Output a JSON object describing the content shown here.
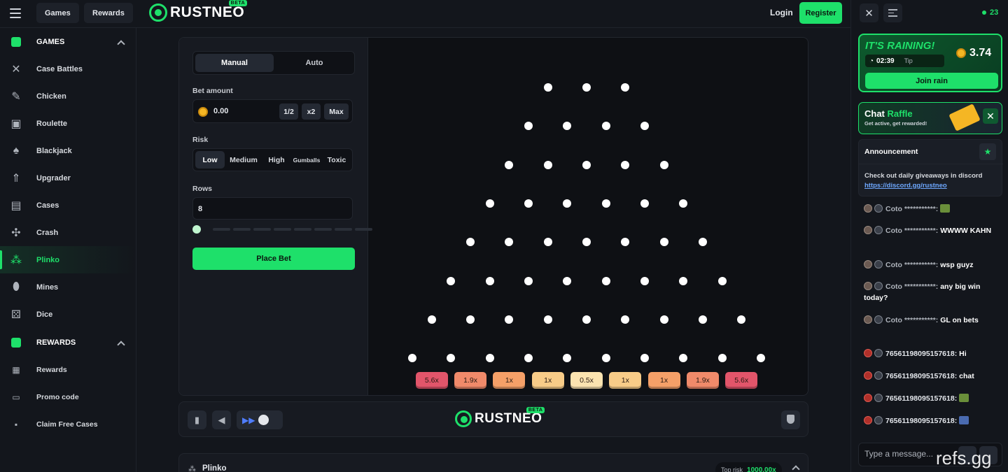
{
  "topbar": {
    "tabs": [
      "Games",
      "Rewards"
    ],
    "logo_text": "RUSTNEO",
    "logo_badge": "BETA",
    "login_label": "Login",
    "register_label": "Register"
  },
  "sidebar": {
    "games_section": "GAMES",
    "games": [
      {
        "label": "Case Battles",
        "icon": "swords-icon"
      },
      {
        "label": "Chicken",
        "icon": "feather-icon"
      },
      {
        "label": "Roulette",
        "icon": "roulette-icon"
      },
      {
        "label": "Blackjack",
        "icon": "cards-icon"
      },
      {
        "label": "Upgrader",
        "icon": "chevrons-up-icon"
      },
      {
        "label": "Cases",
        "icon": "case-icon"
      },
      {
        "label": "Crash",
        "icon": "drone-icon"
      },
      {
        "label": "Plinko",
        "icon": "plinko-icon",
        "active": true
      },
      {
        "label": "Mines",
        "icon": "grenade-icon"
      },
      {
        "label": "Dice",
        "icon": "dice-icon"
      }
    ],
    "rewards_section": "REWARDS",
    "rewards": [
      {
        "label": "Rewards",
        "icon": "calendar-icon"
      },
      {
        "label": "Promo code",
        "icon": "ticket-icon"
      },
      {
        "label": "Claim Free Cases",
        "icon": "box-icon"
      }
    ]
  },
  "controls": {
    "modes": [
      "Manual",
      "Auto"
    ],
    "active_mode": "Manual",
    "bet_label": "Bet amount",
    "bet_value": "0.00",
    "half_label": "1/2",
    "double_label": "x2",
    "max_label": "Max",
    "risk_label": "Risk",
    "risk_options": [
      "Low",
      "Medium",
      "High",
      "Gumballs",
      "Toxic"
    ],
    "active_risk": "Low",
    "rows_label": "Rows",
    "rows_value": "8",
    "rows_slider_fraction": 0.0,
    "place_bet_label": "Place Bet"
  },
  "board": {
    "multipliers": [
      {
        "label": "5.6x",
        "color": "#e2556a"
      },
      {
        "label": "1.9x",
        "color": "#f08a6a"
      },
      {
        "label": "1x",
        "color": "#f5a068"
      },
      {
        "label": "1x",
        "color": "#f8cc88"
      },
      {
        "label": "0.5x",
        "color": "#fbe3b0"
      },
      {
        "label": "1x",
        "color": "#f8cc88"
      },
      {
        "label": "1x",
        "color": "#f5a068"
      },
      {
        "label": "1.9x",
        "color": "#f08a6a"
      },
      {
        "label": "5.6x",
        "color": "#e2556a"
      }
    ]
  },
  "footer": {
    "logo_text": "RUSTNEO",
    "logo_badge": "BETA"
  },
  "bottom_card": {
    "title": "Plinko",
    "top_risk_label": "Top risk",
    "top_risk_value": "1000.00x"
  },
  "chat": {
    "online_count": "23",
    "rain_title": "IT'S RAINING!",
    "rain_amount": "3.74",
    "rain_timer": "02:39",
    "rain_tip": "Tip",
    "join_rain_label": "Join rain",
    "raffle_title_a": "Chat ",
    "raffle_title_b": "Raffle",
    "raffle_sub": "Get active, get rewarded!",
    "announcement_title": "Announcement",
    "announcement_text": "Check out daily giveaways in discord",
    "announcement_link": "https://discord.gg/rustneo",
    "messages": [
      {
        "user": "Coto ***********:",
        "text": ""
      },
      {
        "user": "Coto ***********:",
        "text": "WWWW KAHN"
      },
      {
        "user": "Coto ***********:",
        "text": "wsp guyz"
      },
      {
        "user": "Coto ***********:",
        "text": "any big win today?"
      },
      {
        "user": "Coto ***********:",
        "text": "GL on bets"
      },
      {
        "user": "76561198095157618:",
        "text": "Hi"
      },
      {
        "user": "76561198095157618:",
        "text": "chat"
      },
      {
        "user": "76561198095157618:",
        "text": ""
      },
      {
        "user": "76561198095157618:",
        "text": ""
      }
    ],
    "input_placeholder": "Type a message..."
  },
  "watermark": "refs.gg"
}
